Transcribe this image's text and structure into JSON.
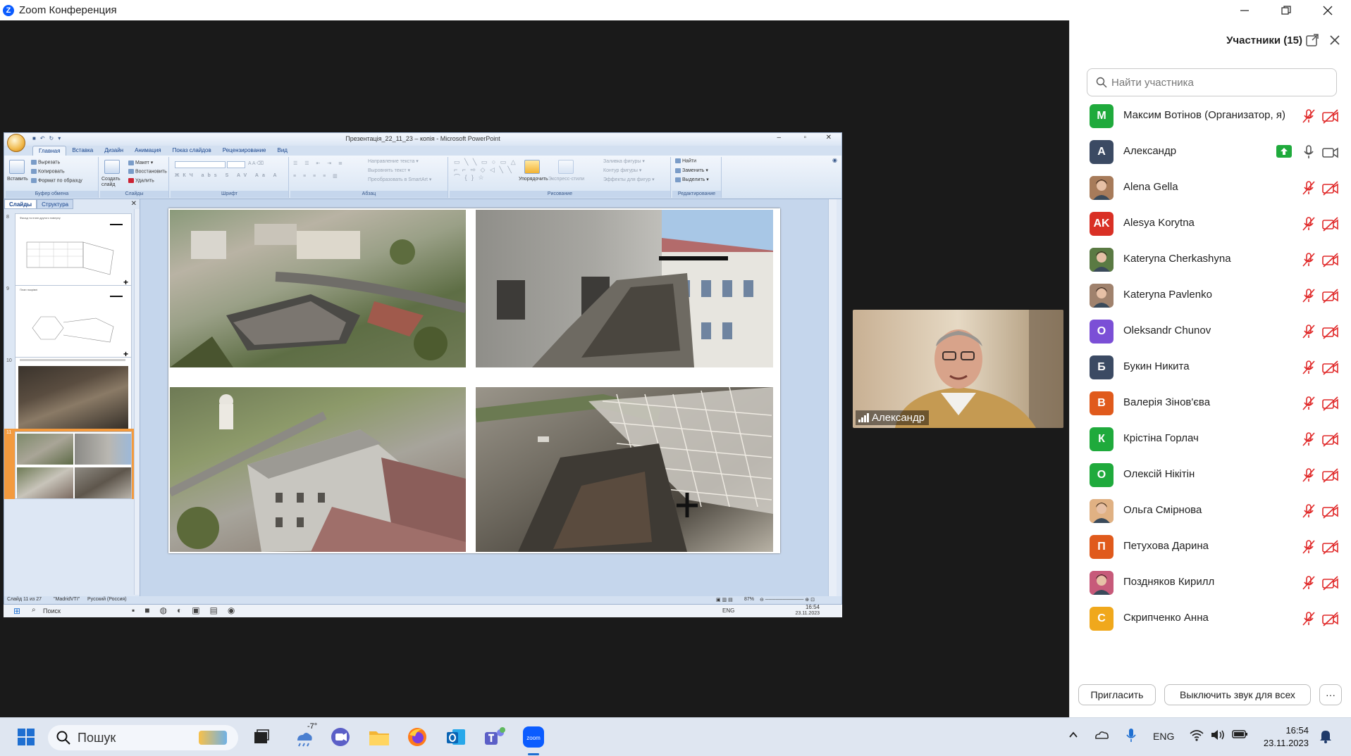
{
  "window": {
    "app_logo": "Z",
    "title": "Zoom Конференция",
    "minimize_icon": "minimize-icon",
    "restore_icon": "restore-icon",
    "close_icon": "close-icon"
  },
  "shared_screen": {
    "window_title": "Презентація_22_11_23 – копія - Microsoft PowerPoint",
    "ribbon_tabs": [
      "Главная",
      "Вставка",
      "Дизайн",
      "Анимация",
      "Показ слайдов",
      "Рецензирование",
      "Вид"
    ],
    "active_tab": "Главная",
    "ribbon": {
      "clipboard": {
        "label": "Буфер обмена",
        "paste": "Вставить",
        "cut": "Вырезать",
        "copy": "Копировать",
        "format_painter": "Формат по образцу"
      },
      "slides": {
        "label": "Слайды",
        "new_slide": "Создать слайд",
        "layout": "Макет",
        "reset": "Восстановить",
        "delete": "Удалить"
      },
      "font": {
        "label": "Шрифт"
      },
      "paragraph": {
        "label": "Абзац",
        "text_direction": "Направление текста",
        "align_text": "Выровнять текст",
        "convert_smartart": "Преобразовать в SmartArt"
      },
      "drawing": {
        "label": "Рисование",
        "arrange": "Упорядочить",
        "quick_styles": "Экспресс-стили",
        "shape_fill": "Заливка фигуры",
        "shape_outline": "Контур фигуры",
        "shape_effects": "Эффекты для фигур"
      },
      "editing": {
        "label": "Редактирование",
        "find": "Найти",
        "replace": "Заменить",
        "select": "Выделить"
      }
    },
    "pane_tabs": [
      "Слайды",
      "Структура"
    ],
    "thumbnails": [
      {
        "number": "8",
        "heading": "Фасад та план другого поверху"
      },
      {
        "number": "9",
        "heading": "План покрівлі"
      },
      {
        "number": "10",
        "heading": ""
      },
      {
        "number": "11",
        "heading": ""
      }
    ],
    "status": {
      "slide_info": "Слайд 11 из 27",
      "theme": "\"MadridVTI\"",
      "language": "Русский (Россия)",
      "zoom": "87%"
    },
    "inner_taskbar": {
      "search": "Поиск",
      "lang": "ENG",
      "time": "16:54",
      "date": "23.11.2023"
    }
  },
  "video_tile": {
    "name": "Александр",
    "signal_icon": "signal-bars-icon"
  },
  "participants_panel": {
    "title": "Участники (15)",
    "search_placeholder": "Найти участника",
    "participants": [
      {
        "initials": "M",
        "name": "Максим Вотінов (Организатор, я)",
        "color": "#1faa3c",
        "mic": "muted",
        "cam": "off"
      },
      {
        "initials": "A",
        "name": "Александр",
        "color": "#3b4a63",
        "mic": "on",
        "cam": "on",
        "sharing": true
      },
      {
        "initials": "",
        "name": "Alena Gella",
        "color": "#a77b5a",
        "photo": true,
        "mic": "muted",
        "cam": "off"
      },
      {
        "initials": "AK",
        "name": "Alesya Korytna",
        "color": "#d93025",
        "mic": "muted",
        "cam": "off"
      },
      {
        "initials": "",
        "name": "Kateryna Cherkashyna",
        "color": "#5a7a43",
        "photo": true,
        "mic": "muted",
        "cam": "off"
      },
      {
        "initials": "",
        "name": "Kateryna Pavlenko",
        "color": "#a0826d",
        "photo": true,
        "mic": "muted",
        "cam": "off"
      },
      {
        "initials": "O",
        "name": "Oleksandr Chunov",
        "color": "#7b4fd6",
        "mic": "muted",
        "cam": "off"
      },
      {
        "initials": "Б",
        "name": "Букин Никита",
        "color": "#3b4a63",
        "mic": "muted",
        "cam": "off"
      },
      {
        "initials": "В",
        "name": "Валерія Зінов'єва",
        "color": "#e05a1c",
        "mic": "muted",
        "cam": "off"
      },
      {
        "initials": "К",
        "name": "Крістіна Горлач",
        "color": "#1faa3c",
        "mic": "muted",
        "cam": "off"
      },
      {
        "initials": "О",
        "name": "Олексій Нікітін",
        "color": "#1faa3c",
        "mic": "muted",
        "cam": "off"
      },
      {
        "initials": "",
        "name": "Ольга Смірнова",
        "color": "#e0b183",
        "photo": true,
        "mic": "muted",
        "cam": "off"
      },
      {
        "initials": "П",
        "name": "Петухова Дарина",
        "color": "#e05a1c",
        "mic": "muted",
        "cam": "off"
      },
      {
        "initials": "",
        "name": "Поздняков Кирилл",
        "color": "#c75a7a",
        "photo": true,
        "mic": "muted",
        "cam": "off"
      },
      {
        "initials": "С",
        "name": "Скрипченко Анна",
        "color": "#f0a81c",
        "mic": "muted",
        "cam": "off"
      }
    ],
    "invite_button": "Пригласить",
    "mute_all_button": "Выключить звук для всех",
    "more_button": "···"
  },
  "taskbar": {
    "search_label": "Пошук",
    "weather": "-7°",
    "lang": "ENG",
    "time": "16:54",
    "date": "23.11.2023",
    "apps": [
      "start-icon",
      "search-icon",
      "widgets-icon",
      "task-view-icon",
      "weather-icon",
      "chat-icon",
      "file-explorer-icon",
      "firefox-icon",
      "outlook-icon",
      "teams-icon",
      "zoom-icon"
    ]
  }
}
